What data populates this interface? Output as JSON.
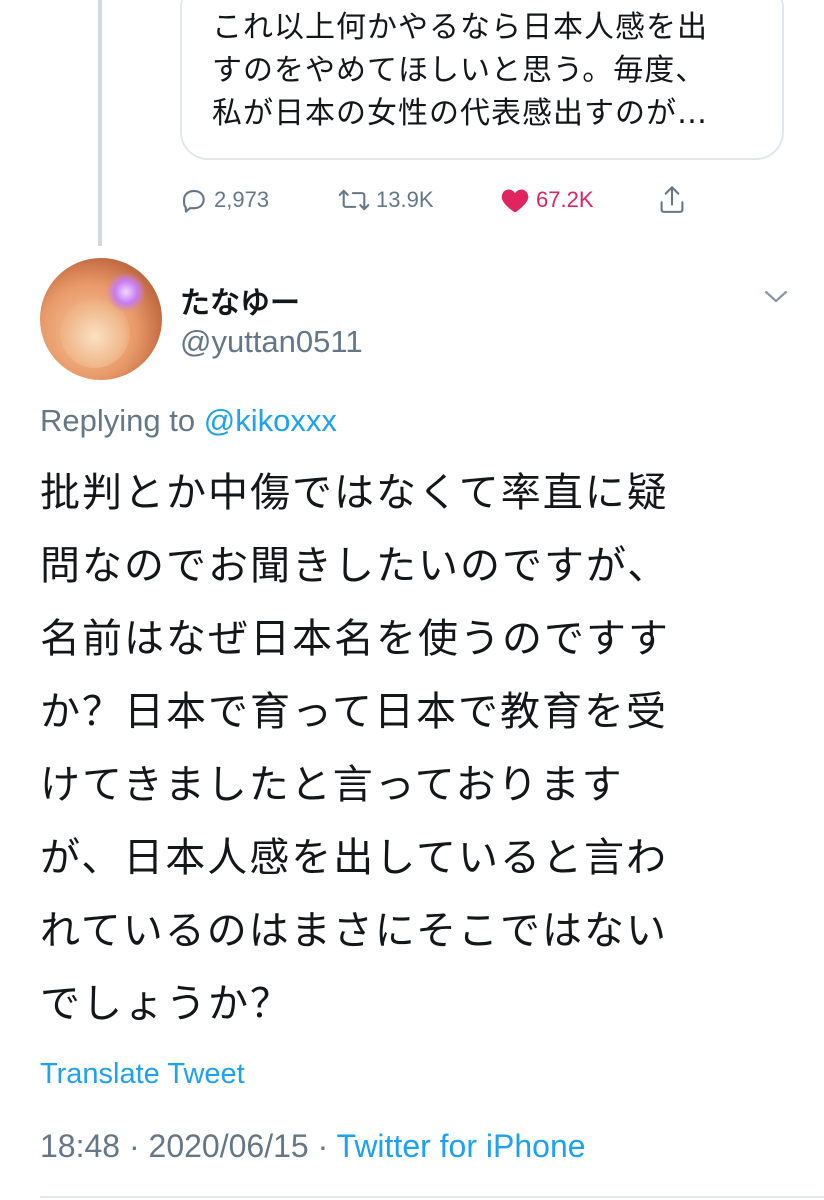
{
  "quoted_tweet": {
    "lines": [
      "これ以上何かやるなら日本人感を出",
      "すのをやめてほしいと思う。毎度、",
      "私が日本の女性の代表感出すのが…"
    ]
  },
  "actions": {
    "reply_count": "2,973",
    "retweet_count": "13.9K",
    "like_count": "67.2K",
    "like_color": "#e0245e"
  },
  "author": {
    "name": "たなゆー",
    "handle": "@yuttan0511"
  },
  "reply": {
    "prefix": "Replying to",
    "mention": "@kikoxxx"
  },
  "tweet": {
    "lines": [
      "批判とか中傷ではなくて率直に疑",
      "問なのでお聞きしたいのですが、",
      "名前はなぜ日本名を使うのですす",
      "か？日本で育って日本で教育を受",
      "けてきましたと言っております",
      "が、日本人感を出していると言わ",
      "れているのはまさにそこではない",
      "でしょうか？"
    ]
  },
  "translate_label": "Translate Tweet",
  "meta": {
    "time": "18:48",
    "date": "2020/06/15",
    "separator": "·",
    "source": "Twitter for iPhone"
  },
  "colors": {
    "link": "#1da1f2",
    "secondary": "#657786",
    "text": "#14171a"
  },
  "icons": [
    "reply-icon",
    "retweet-icon",
    "heart-icon",
    "share-icon",
    "chevron-down-icon"
  ]
}
